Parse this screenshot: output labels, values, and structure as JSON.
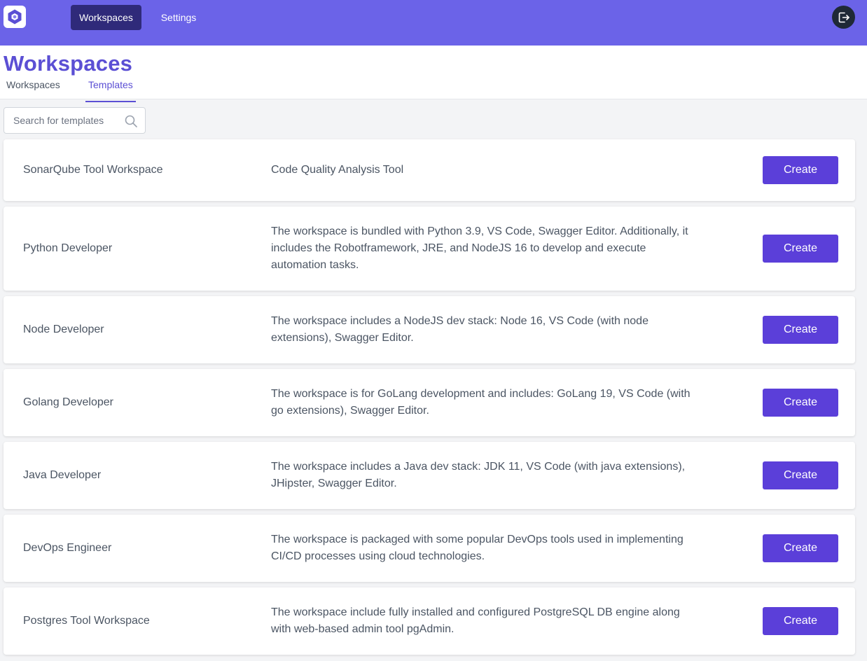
{
  "nav": {
    "logo_icon": "hexagon-logo-icon",
    "items": [
      {
        "label": "Workspaces",
        "active": true
      },
      {
        "label": "Settings",
        "active": false
      }
    ],
    "logout_icon": "logout-icon"
  },
  "page": {
    "title": "Workspaces",
    "tabs": [
      {
        "label": "Workspaces",
        "active": false
      },
      {
        "label": "Templates",
        "active": true
      }
    ]
  },
  "search": {
    "placeholder": "Search for templates",
    "icon": "search-icon"
  },
  "templates": [
    {
      "name": "SonarQube Tool Workspace",
      "description": "Code Quality Analysis Tool",
      "action": "Create"
    },
    {
      "name": "Python Developer",
      "description": "The workspace is bundled with Python 3.9, VS Code, Swagger Editor. Additionally, it includes the Robotframework, JRE, and NodeJS 16 to develop and execute automation tasks.",
      "action": "Create"
    },
    {
      "name": "Node Developer",
      "description": "The workspace includes a NodeJS dev stack: Node 16, VS Code (with node extensions), Swagger Editor.",
      "action": "Create"
    },
    {
      "name": "Golang Developer",
      "description": "The workspace is for GoLang development and includes: GoLang 19, VS Code (with go extensions), Swagger Editor.",
      "action": "Create"
    },
    {
      "name": "Java Developer",
      "description": "The workspace includes a Java dev stack: JDK 11, VS Code (with java extensions), JHipster, Swagger Editor.",
      "action": "Create"
    },
    {
      "name": "DevOps Engineer",
      "description": "The workspace is packaged with some popular DevOps tools used in implementing CI/CD processes using cloud technologies.",
      "action": "Create"
    },
    {
      "name": "Postgres Tool Workspace",
      "description": "The workspace include fully installed and configured PostgreSQL DB engine along with web-based admin tool pgAdmin.",
      "action": "Create"
    }
  ],
  "colors": {
    "topbar": "#6b63e8",
    "nav_active": "#2f2a7a",
    "accent": "#5b4fd4",
    "button": "#5b3fd9"
  }
}
